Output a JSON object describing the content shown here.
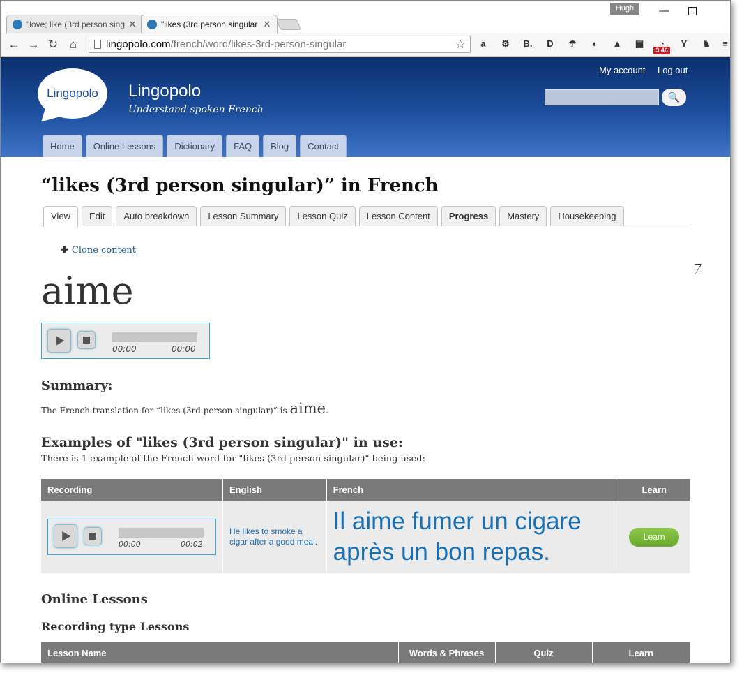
{
  "browser": {
    "profile_name": "Hugh",
    "tabs": [
      {
        "title": "\"love; like (3rd person sing"
      },
      {
        "title": "\"likes (3rd person singular"
      }
    ],
    "url_host": "lingopolo.com",
    "url_path": "/french/word/likes-3rd-person-singular",
    "extension_badge": "3.46",
    "extensions": [
      "a",
      "⚙",
      "B.",
      "D",
      "☂",
      "◐",
      "▲",
      "▣",
      "Y",
      "♞"
    ]
  },
  "site": {
    "logo_text": "Lingopolo",
    "name": "Lingopolo",
    "slogan": "Understand spoken French",
    "user_links": [
      "My account",
      "Log out"
    ],
    "nav": [
      "Home",
      "Online Lessons",
      "Dictionary",
      "FAQ",
      "Blog",
      "Contact"
    ]
  },
  "page": {
    "title": "“likes (3rd person singular)” in French",
    "tabs": [
      "View",
      "Edit",
      "Auto breakdown",
      "Lesson Summary",
      "Lesson Quiz",
      "Lesson Content",
      "Progress",
      "Mastery",
      "Housekeeping"
    ],
    "clone_link": "Clone content",
    "word": "aime",
    "player": {
      "current": "00:00",
      "duration": "00:00"
    },
    "summary_heading": "Summary:",
    "summary_prefix": "The French translation for “likes (3rd person singular)” is ",
    "summary_word": "aime",
    "summary_suffix": ".",
    "examples_heading": "Examples of \"likes (3rd person singular)\" in use:",
    "examples_intro": "There is 1 example of the French word for \"likes (3rd person singular)\" being used:",
    "examples_table": {
      "headers": [
        "Recording",
        "English",
        "French",
        "Learn"
      ],
      "rows": [
        {
          "player_current": "00:00",
          "player_duration": "00:02",
          "english": "He likes to smoke a cigar after a good meal.",
          "french": "Il aime fumer un cigare après un bon repas.",
          "learn_label": "Learn"
        }
      ]
    },
    "online_lessons_heading": "Online Lessons",
    "recording_lessons_heading": "Recording type Lessons",
    "lessons_table": {
      "headers": [
        "Lesson Name",
        "Words & Phrases",
        "Quiz",
        "Learn"
      ]
    }
  }
}
